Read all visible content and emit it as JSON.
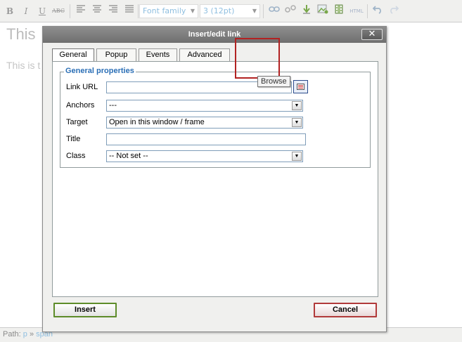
{
  "editor": {
    "toolbar": {
      "bold": "B",
      "italic": "I",
      "underline": "U",
      "strikethrough": "ABC",
      "font_family": "Font family",
      "font_size": "3 (12pt)",
      "html_label": "HTML"
    },
    "heading_text": "This",
    "body_text": "This is t",
    "status": {
      "path_label": "Path:",
      "path_p": "p",
      "sep": "»",
      "path_span": "span"
    }
  },
  "dialog": {
    "title": "Insert/edit link",
    "close_glyph": "✕",
    "tabs": [
      {
        "label": "General"
      },
      {
        "label": "Popup"
      },
      {
        "label": "Events"
      },
      {
        "label": "Advanced"
      }
    ],
    "fieldset_legend": "General properties",
    "fields": {
      "link_url_label": "Link URL",
      "link_url_value": "",
      "anchors_label": "Anchors",
      "anchors_value": "---",
      "target_label": "Target",
      "target_value": "Open in this window / frame",
      "title_label": "Title",
      "title_value": "",
      "class_label": "Class",
      "class_value": "-- Not set --"
    },
    "browse_tooltip": "Browse",
    "insert_label": "Insert",
    "cancel_label": "Cancel"
  }
}
